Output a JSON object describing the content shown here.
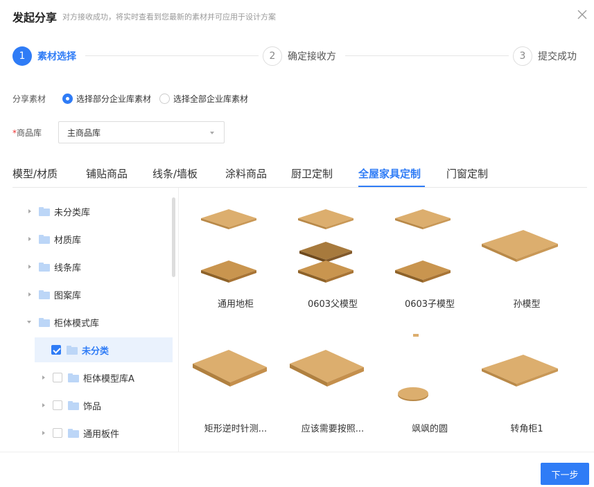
{
  "header": {
    "title": "发起分享",
    "subtitle": "对方接收成功，将实时查看到您最新的素材并可应用于设计方案"
  },
  "steps": [
    {
      "num": "1",
      "label": "素材选择"
    },
    {
      "num": "2",
      "label": "确定接收方"
    },
    {
      "num": "3",
      "label": "提交成功"
    }
  ],
  "share": {
    "label": "分享素材",
    "options": [
      "选择部分企业库素材",
      "选择全部企业库素材"
    ],
    "selected": "选择部分企业库素材"
  },
  "library": {
    "required_mark": "*",
    "label": "商品库",
    "value": "主商品库"
  },
  "tabs": [
    "模型/材质",
    "铺贴商品",
    "线条/墙板",
    "涂料商品",
    "厨卫定制",
    "全屋家具定制",
    "门窗定制"
  ],
  "active_tab": "全屋家具定制",
  "tree": [
    {
      "label": "未分类库",
      "expanded": false,
      "checkbox": false
    },
    {
      "label": "材质库",
      "expanded": false,
      "checkbox": false
    },
    {
      "label": "线条库",
      "expanded": false,
      "checkbox": false
    },
    {
      "label": "图案库",
      "expanded": false,
      "checkbox": false
    },
    {
      "label": "柜体模式库",
      "expanded": true,
      "checkbox": false
    },
    {
      "label": "未分类",
      "checkbox": true,
      "checked": true,
      "selected": true
    },
    {
      "label": "柜体模型库A",
      "checkbox": true,
      "checked": false
    },
    {
      "label": "饰品",
      "checkbox": true,
      "checked": false
    },
    {
      "label": "通用板件",
      "checkbox": true,
      "checked": false
    }
  ],
  "items": [
    {
      "name": "通用地柜",
      "thumb": "two-boards"
    },
    {
      "name": "0603父模型",
      "thumb": "three-boards"
    },
    {
      "name": "0603子模型",
      "thumb": "two-boards"
    },
    {
      "name": "孙模型",
      "thumb": "single-board"
    },
    {
      "name": "矩形逆时针测...",
      "thumb": "thick-board"
    },
    {
      "name": "应该需要按照...",
      "thumb": "thick-board"
    },
    {
      "name": "飒飒的圆",
      "thumb": "round-disc"
    },
    {
      "name": "转角柜1",
      "thumb": "single-board"
    }
  ],
  "footer": {
    "next_label": "下一步"
  },
  "colors": {
    "accent": "#2f7cf6",
    "wood": "#dcae6e"
  }
}
